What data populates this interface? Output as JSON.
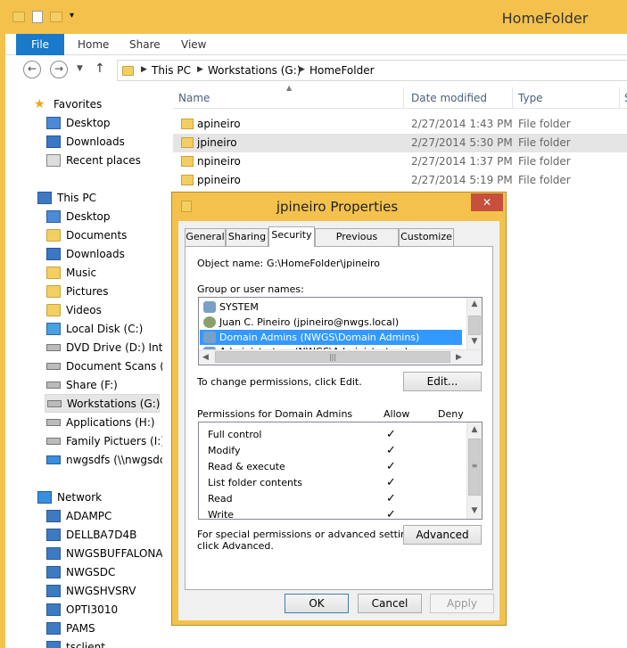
{
  "window": {
    "title": "HomeFolder",
    "accent": "#f4c24c"
  },
  "ribbon": {
    "file": "File",
    "home": "Home",
    "share": "Share",
    "view": "View"
  },
  "address": {
    "crumbs": [
      "This PC",
      "Workstations (G:)",
      "HomeFolder"
    ]
  },
  "nav": {
    "favorites": "Favorites",
    "fav_items": [
      "Desktop",
      "Downloads",
      "Recent places"
    ],
    "thispc": "This PC",
    "pc_items": [
      "Desktop",
      "Documents",
      "Downloads",
      "Music",
      "Pictures",
      "Videos",
      "Local Disk (C:)",
      "DVD Drive (D:) Integ",
      "Document Scans (E:",
      "Share (F:)",
      "Workstations (G:)",
      "Applications (H:)",
      "Family Pictuers (I:)",
      "nwgsdfs (\\\\nwgsdc)"
    ],
    "network": "Network",
    "net_items": [
      "ADAMPC",
      "DELLBA7D4B",
      "NWGSBUFFALONAS",
      "NWGSDC",
      "NWGSHVSRV",
      "OPTI3010",
      "PAMS",
      "tsclient"
    ]
  },
  "files": {
    "headers": [
      "Name",
      "Date modified",
      "Type",
      "Si"
    ],
    "rows": [
      {
        "name": "apineiro",
        "date": "2/27/2014 1:43 PM",
        "type": "File folder"
      },
      {
        "name": "jpineiro",
        "date": "2/27/2014 5:30 PM",
        "type": "File folder"
      },
      {
        "name": "npineiro",
        "date": "2/27/2014 1:37 PM",
        "type": "File folder"
      },
      {
        "name": "ppineiro",
        "date": "2/27/2014 5:19 PM",
        "type": "File folder"
      }
    ]
  },
  "dialog": {
    "title": "jpineiro Properties",
    "close": "✕",
    "tabs": [
      "General",
      "Sharing",
      "Security",
      "Previous Versions",
      "Customize"
    ],
    "object_label": "Object name:",
    "object_value": "G:\\HomeFolder\\jpineiro",
    "group_label": "Group or user names:",
    "users": [
      "SYSTEM",
      "Juan C. Pineiro (jpineiro@nwgs.local)",
      "Domain Admins (NWGS\\Domain Admins)",
      "Administrators (NWGS\\Administrators)"
    ],
    "change_text": "To change permissions, click Edit.",
    "edit_btn": "Edit...",
    "perm_label": "Permissions for Domain Admins",
    "allow": "Allow",
    "deny": "Deny",
    "permissions": [
      "Full control",
      "Modify",
      "Read & execute",
      "List folder contents",
      "Read",
      "Write"
    ],
    "check": "✓",
    "special_text_1": "For special permissions or advanced settings,",
    "special_text_2": "click Advanced.",
    "advanced_btn": "Advanced",
    "ok": "OK",
    "cancel": "Cancel",
    "apply": "Apply"
  }
}
